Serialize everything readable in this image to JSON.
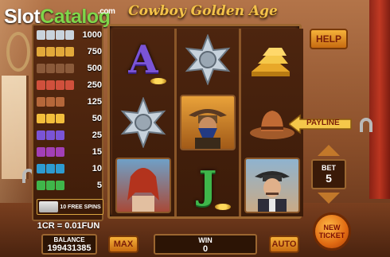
{
  "logo": {
    "slot": "Slot",
    "catalog": "Catalog",
    "com": ".com"
  },
  "game_title": "Cowboy Golden Age",
  "paytable": {
    "rows": [
      {
        "symbol": "sheriff-star-icon",
        "value": "1000"
      },
      {
        "symbol": "gold-bars-icon",
        "value": "750"
      },
      {
        "symbol": "cowboy-portrait-icon",
        "value": "500"
      },
      {
        "symbol": "lady-portrait-icon",
        "value": "250"
      },
      {
        "symbol": "cowboy-hat-icon",
        "value": "125"
      },
      {
        "symbol": "gold-icon",
        "value": "50"
      },
      {
        "symbol": "letter-a-icon",
        "value": "25"
      },
      {
        "symbol": "letter-k-icon",
        "value": "15"
      },
      {
        "symbol": "letter-q-icon",
        "value": "10"
      },
      {
        "symbol": "letter-j-icon",
        "value": "5"
      }
    ],
    "free_spins": "10 FREE SPINS"
  },
  "credit_rate": "1CR = 0.01FUN",
  "reels": {
    "reel1": [
      "letter-a",
      "sheriff-star",
      "lady-portrait"
    ],
    "reel2": [
      "sheriff-star",
      "bandit-portrait",
      "letter-j"
    ],
    "reel3": [
      "gold-bars",
      "cowboy-hat",
      "sheriff-portrait"
    ]
  },
  "controls": {
    "help": "HELP",
    "paytable": "PAYLINE",
    "bet_label": "BET",
    "bet_value": "5",
    "new_ticket_line1": "NEW",
    "new_ticket_line2": "TICKET",
    "max": "MAX",
    "auto": "AUTO"
  },
  "balance": {
    "label": "BALANCE",
    "value": "199431385"
  },
  "win": {
    "label": "WIN",
    "value": "0"
  },
  "colors": {
    "gold": "#f3c24a",
    "button_orange": "#e8902a",
    "wood": "#6b3718",
    "logo_green": "#7fd64a"
  }
}
